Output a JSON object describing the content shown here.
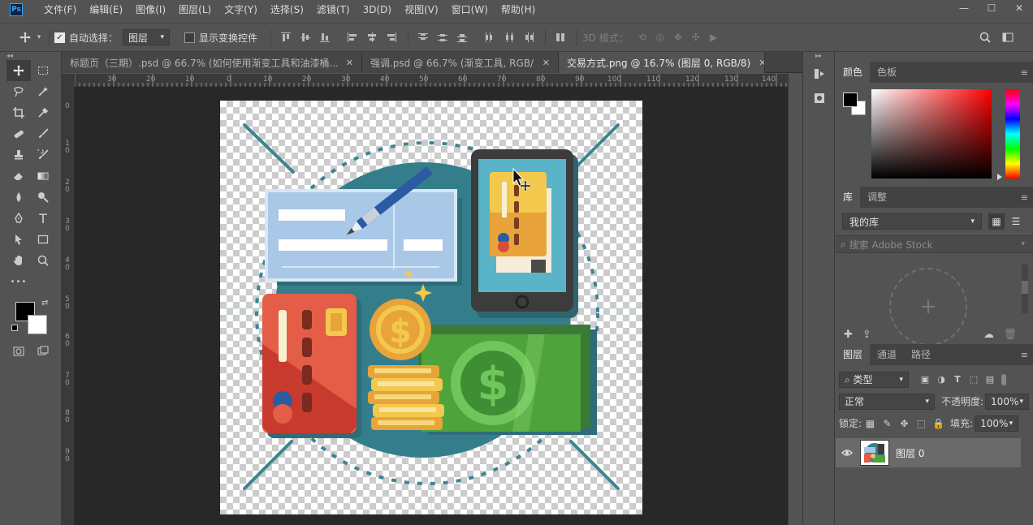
{
  "app": {
    "logo": "Ps",
    "menu": [
      "文件(F)",
      "编辑(E)",
      "图像(I)",
      "图层(L)",
      "文字(Y)",
      "选择(S)",
      "滤镜(T)",
      "3D(D)",
      "视图(V)",
      "窗口(W)",
      "帮助(H)"
    ],
    "window_controls": {
      "minimize": "—",
      "maximize": "☐",
      "close": "✕"
    }
  },
  "options_bar": {
    "auto_select_label": "自动选择：",
    "auto_select_checked": true,
    "auto_select_target": "图层",
    "show_transform_label": "显示变换控件",
    "show_transform_checked": false,
    "mode_3d_label": "3D 模式："
  },
  "tools": {
    "toolbar_collapse": "◂◂",
    "rows": [
      [
        "move-tool",
        "marquee-tool"
      ],
      [
        "lasso-tool",
        "magic-wand-tool"
      ],
      [
        "crop-tool",
        "eyedropper-tool"
      ],
      [
        "healing-brush-tool",
        "brush-tool"
      ],
      [
        "stamp-tool",
        "history-brush-tool"
      ],
      [
        "eraser-tool",
        "gradient-tool"
      ],
      [
        "blur-tool",
        "dodge-tool"
      ],
      [
        "pen-tool",
        "type-tool"
      ],
      [
        "path-select-tool",
        "rectangle-tool"
      ],
      [
        "hand-tool",
        "zoom-tool"
      ]
    ],
    "type_tool_glyph": "T",
    "more_glyph": "•••"
  },
  "document_tabs": [
    {
      "label": "标题页（三期）.psd @ 66.7% (如何使用渐变工具和油漆桶...",
      "active": false
    },
    {
      "label": "强调.psd @ 66.7% (渐变工具, RGB/...",
      "active": false
    },
    {
      "label": "交易方式.png @ 16.7% (图层 0, RGB/8)",
      "active": true
    }
  ],
  "tab_close_glyph": "✕",
  "ruler": {
    "horizontal": [
      "30",
      "20",
      "10",
      "0",
      "10",
      "20",
      "30",
      "40",
      "50",
      "60",
      "70",
      "80",
      "90",
      "100",
      "110",
      "120",
      "130",
      "140"
    ],
    "vertical": [
      "0",
      "1 0",
      "2 0",
      "3 0",
      "4 0",
      "5 0",
      "6 0",
      "7 0",
      "8 0",
      "9 0"
    ]
  },
  "panels": {
    "color": {
      "tabs": [
        "颜色",
        "色板"
      ],
      "foreground": "#000000",
      "background": "#ffffff"
    },
    "library": {
      "tabs": [
        "库",
        "调整"
      ],
      "library_name": "我的库",
      "search_placeholder": "搜索 Adobe Stock",
      "add_glyph": "+"
    },
    "layers": {
      "tabs": [
        "图层",
        "通道",
        "路径"
      ],
      "filter_kind": "类型",
      "blend_mode": "正常",
      "opacity_label": "不透明度:",
      "opacity_value": "100%",
      "lock_label": "锁定:",
      "fill_label": "填充:",
      "fill_value": "100%",
      "layer_name": "图层 0"
    },
    "menu_glyph": "≡",
    "collapse_glyph": "▸▸"
  },
  "colors": {
    "accent_blue": "#31a8ff",
    "ui_bg": "#535353",
    "canvas_bg": "#282828"
  }
}
